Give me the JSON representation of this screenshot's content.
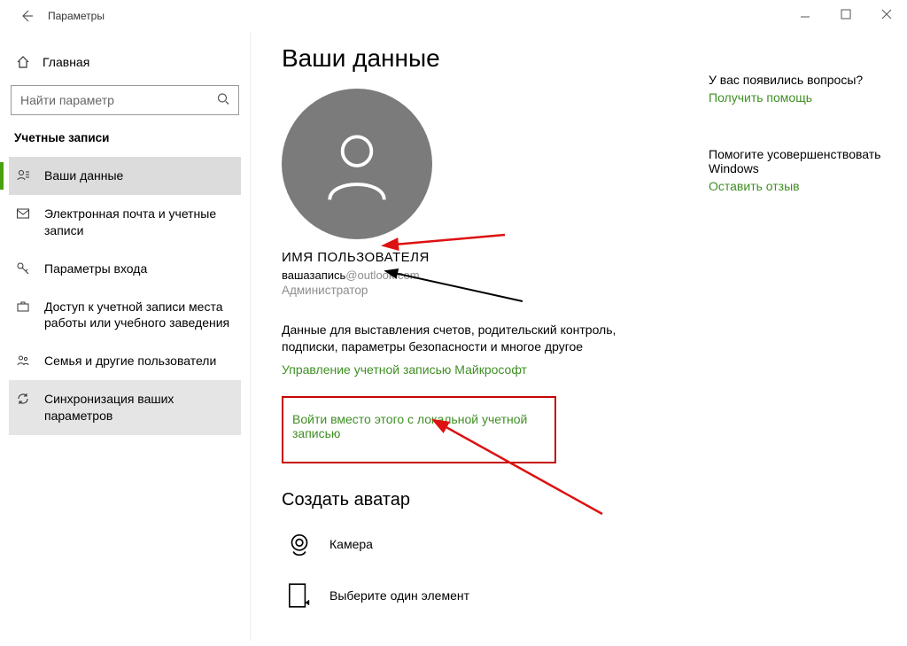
{
  "window": {
    "title": "Параметры"
  },
  "sidebar": {
    "home": "Главная",
    "search_placeholder": "Найти параметр",
    "section": "Учетные записи",
    "items": [
      {
        "label": "Ваши данные"
      },
      {
        "label": "Электронная почта и учетные записи"
      },
      {
        "label": "Параметры входа"
      },
      {
        "label": "Доступ к учетной записи места работы или учебного заведения"
      },
      {
        "label": "Семья и другие пользователи"
      },
      {
        "label": "Синхронизация ваших параметров"
      }
    ]
  },
  "main": {
    "heading": "Ваши данные",
    "username": "ИМЯ ПОЛЬЗОВАТЕЛЯ",
    "email_local": "вашазапись",
    "email_domain": "@outlook.com",
    "role": "Администратор",
    "description": "Данные для выставления счетов, родительский контроль, подписки, параметры безопасности и многое другое",
    "manage_link": "Управление учетной записью Майкрософт",
    "local_login_link": "Войти вместо этого с локальной учетной записью",
    "create_avatar": "Создать аватар",
    "camera": "Камера",
    "browse": "Выберите один элемент"
  },
  "right": {
    "questions": "У вас появились вопросы?",
    "help": "Получить помощь",
    "feedback_head": "Помогите усовершенствовать Windows",
    "feedback_link": "Оставить отзыв"
  }
}
